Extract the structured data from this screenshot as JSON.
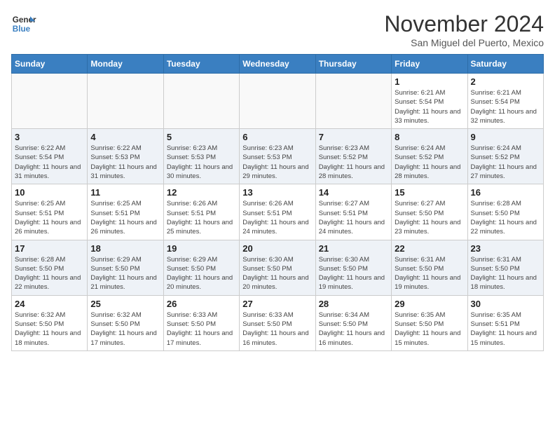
{
  "header": {
    "logo_line1": "General",
    "logo_line2": "Blue",
    "month": "November 2024",
    "location": "San Miguel del Puerto, Mexico"
  },
  "weekdays": [
    "Sunday",
    "Monday",
    "Tuesday",
    "Wednesday",
    "Thursday",
    "Friday",
    "Saturday"
  ],
  "weeks": [
    [
      {
        "day": "",
        "info": ""
      },
      {
        "day": "",
        "info": ""
      },
      {
        "day": "",
        "info": ""
      },
      {
        "day": "",
        "info": ""
      },
      {
        "day": "",
        "info": ""
      },
      {
        "day": "1",
        "info": "Sunrise: 6:21 AM\nSunset: 5:54 PM\nDaylight: 11 hours and 33 minutes."
      },
      {
        "day": "2",
        "info": "Sunrise: 6:21 AM\nSunset: 5:54 PM\nDaylight: 11 hours and 32 minutes."
      }
    ],
    [
      {
        "day": "3",
        "info": "Sunrise: 6:22 AM\nSunset: 5:54 PM\nDaylight: 11 hours and 31 minutes."
      },
      {
        "day": "4",
        "info": "Sunrise: 6:22 AM\nSunset: 5:53 PM\nDaylight: 11 hours and 31 minutes."
      },
      {
        "day": "5",
        "info": "Sunrise: 6:23 AM\nSunset: 5:53 PM\nDaylight: 11 hours and 30 minutes."
      },
      {
        "day": "6",
        "info": "Sunrise: 6:23 AM\nSunset: 5:53 PM\nDaylight: 11 hours and 29 minutes."
      },
      {
        "day": "7",
        "info": "Sunrise: 6:23 AM\nSunset: 5:52 PM\nDaylight: 11 hours and 28 minutes."
      },
      {
        "day": "8",
        "info": "Sunrise: 6:24 AM\nSunset: 5:52 PM\nDaylight: 11 hours and 28 minutes."
      },
      {
        "day": "9",
        "info": "Sunrise: 6:24 AM\nSunset: 5:52 PM\nDaylight: 11 hours and 27 minutes."
      }
    ],
    [
      {
        "day": "10",
        "info": "Sunrise: 6:25 AM\nSunset: 5:51 PM\nDaylight: 11 hours and 26 minutes."
      },
      {
        "day": "11",
        "info": "Sunrise: 6:25 AM\nSunset: 5:51 PM\nDaylight: 11 hours and 26 minutes."
      },
      {
        "day": "12",
        "info": "Sunrise: 6:26 AM\nSunset: 5:51 PM\nDaylight: 11 hours and 25 minutes."
      },
      {
        "day": "13",
        "info": "Sunrise: 6:26 AM\nSunset: 5:51 PM\nDaylight: 11 hours and 24 minutes."
      },
      {
        "day": "14",
        "info": "Sunrise: 6:27 AM\nSunset: 5:51 PM\nDaylight: 11 hours and 24 minutes."
      },
      {
        "day": "15",
        "info": "Sunrise: 6:27 AM\nSunset: 5:50 PM\nDaylight: 11 hours and 23 minutes."
      },
      {
        "day": "16",
        "info": "Sunrise: 6:28 AM\nSunset: 5:50 PM\nDaylight: 11 hours and 22 minutes."
      }
    ],
    [
      {
        "day": "17",
        "info": "Sunrise: 6:28 AM\nSunset: 5:50 PM\nDaylight: 11 hours and 22 minutes."
      },
      {
        "day": "18",
        "info": "Sunrise: 6:29 AM\nSunset: 5:50 PM\nDaylight: 11 hours and 21 minutes."
      },
      {
        "day": "19",
        "info": "Sunrise: 6:29 AM\nSunset: 5:50 PM\nDaylight: 11 hours and 20 minutes."
      },
      {
        "day": "20",
        "info": "Sunrise: 6:30 AM\nSunset: 5:50 PM\nDaylight: 11 hours and 20 minutes."
      },
      {
        "day": "21",
        "info": "Sunrise: 6:30 AM\nSunset: 5:50 PM\nDaylight: 11 hours and 19 minutes."
      },
      {
        "day": "22",
        "info": "Sunrise: 6:31 AM\nSunset: 5:50 PM\nDaylight: 11 hours and 19 minutes."
      },
      {
        "day": "23",
        "info": "Sunrise: 6:31 AM\nSunset: 5:50 PM\nDaylight: 11 hours and 18 minutes."
      }
    ],
    [
      {
        "day": "24",
        "info": "Sunrise: 6:32 AM\nSunset: 5:50 PM\nDaylight: 11 hours and 18 minutes."
      },
      {
        "day": "25",
        "info": "Sunrise: 6:32 AM\nSunset: 5:50 PM\nDaylight: 11 hours and 17 minutes."
      },
      {
        "day": "26",
        "info": "Sunrise: 6:33 AM\nSunset: 5:50 PM\nDaylight: 11 hours and 17 minutes."
      },
      {
        "day": "27",
        "info": "Sunrise: 6:33 AM\nSunset: 5:50 PM\nDaylight: 11 hours and 16 minutes."
      },
      {
        "day": "28",
        "info": "Sunrise: 6:34 AM\nSunset: 5:50 PM\nDaylight: 11 hours and 16 minutes."
      },
      {
        "day": "29",
        "info": "Sunrise: 6:35 AM\nSunset: 5:50 PM\nDaylight: 11 hours and 15 minutes."
      },
      {
        "day": "30",
        "info": "Sunrise: 6:35 AM\nSunset: 5:51 PM\nDaylight: 11 hours and 15 minutes."
      }
    ]
  ]
}
